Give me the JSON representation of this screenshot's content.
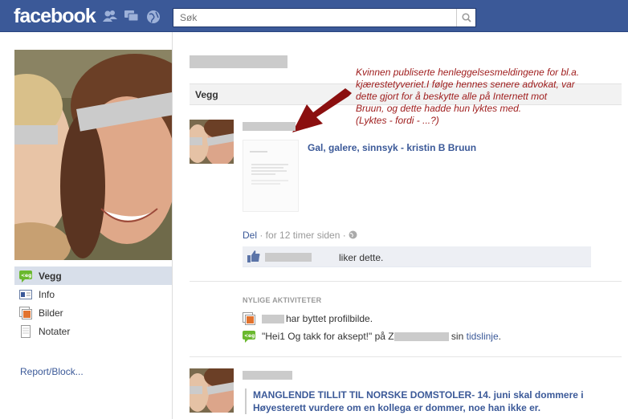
{
  "header": {
    "logo": "facebook",
    "search_placeholder": "Søk"
  },
  "sidebar": {
    "items": [
      {
        "label": "Vegg",
        "icon": "wall-icon",
        "active": true
      },
      {
        "label": "Info",
        "icon": "info-icon",
        "active": false
      },
      {
        "label": "Bilder",
        "icon": "photos-icon",
        "active": false
      },
      {
        "label": "Notater",
        "icon": "notes-icon",
        "active": false
      }
    ],
    "report_label": "Report/Block..."
  },
  "main": {
    "tab_title": "Vegg",
    "annotation": [
      "Kvinnen publiserte henleggelsesmeldingene for bl.a.",
      "kjærestetyveriet.I følge  hennes senere advokat, var",
      "dette gjort for å beskytte alle på Internett mot",
      "Bruun, og dette hadde hun lyktes med.",
      "(Lyktes - fordi - ...?)"
    ],
    "post1": {
      "link_title": "Gal, galere, sinnsyk - kristin B Bruun",
      "share_label": "Del",
      "time_text": " · for 12 timer siden · ",
      "likes_text": "liker dette."
    },
    "recent": {
      "heading": "NYLIGE AKTIVITETER",
      "item1_text": "har byttet profilbilde.",
      "item2_quote": "\"Hei1 Og takk for aksept!\" på Z",
      "item2_mid": " sin ",
      "item2_link": "tidslinje",
      "item2_end": "."
    },
    "post2": {
      "quote": "MANGLENDE TILLIT TIL NORSKE DOMSTOLER- 14. juni skal dommere i Høyesterett vurdere om en kollega er dommer, noe han ikke er."
    }
  },
  "colors": {
    "brand": "#3b5998",
    "annotation": "#9e1b1b",
    "arrow": "#8b0f0f",
    "redaction": "#cbcbcb"
  }
}
